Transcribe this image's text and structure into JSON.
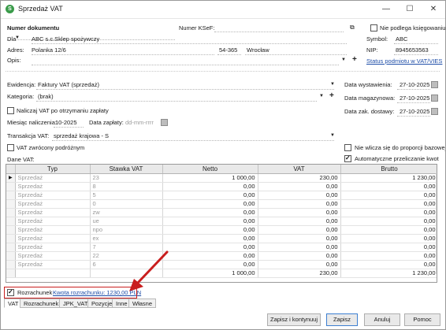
{
  "window": {
    "title": "Sprzedaż VAT",
    "minimize": "—",
    "maximize": "☐",
    "close": "✕"
  },
  "header": {
    "doc_number_label": "Numer dokumentu",
    "ksef_label": "Numer KSeF:",
    "not_booked_label": "Nie podlega księgowaniu",
    "dla_label": "Dla",
    "customer_name": "ABC s.c.Sklep spożywczy",
    "symbol_label": "Symbol:",
    "symbol_value": "ABC",
    "address_label": "Adres:",
    "street": "Polanka 12/6",
    "postal_code": "54-365",
    "city": "Wrocław",
    "nip_label": "NIP:",
    "nip_value": "8945653563",
    "opis_label": "Opis:",
    "vat_status_link": "Status podmiotu w VAT/VIES"
  },
  "details": {
    "ewidencja_label": "Ewidencja:",
    "ewidencja_value": "Faktury VAT (sprzedaż)",
    "kategoria_label": "Kategoria:",
    "kategoria_value": "(brak)",
    "naliczaj_label": "Naliczaj VAT po otrzymaniu zapłaty",
    "miesiac_label": "Miesiąc naliczenia:",
    "miesiac_value": "10-2025",
    "data_zaplaty_label": "Data zapłaty:",
    "data_zaplaty_placeholder": "dd-mm-rrrr",
    "transakcja_label": "Transakcja VAT:",
    "transakcja_value": "sprzedaż krajowa - S",
    "vat_zwrocony_label": "VAT zwrócony podróżnym",
    "dane_vat_label": "Dane VAT:",
    "data_wystawienia_label": "Data wystawienia:",
    "data_wystawienia_value": "27-10-2025",
    "data_magazynowa_label": "Data magazynowa:",
    "data_magazynowa_value": "27-10-2025",
    "data_zak_dostawy_label": "Data zak. dostawy:",
    "data_zak_dostawy_value": "27-10-2025",
    "nie_wlicza_label": "Nie wlicza się do proporcji bazowej",
    "auto_przelicz_label": "Automatyczne przeliczanie kwot"
  },
  "table": {
    "columns": [
      "Typ",
      "Stawka VAT",
      "Netto",
      "VAT",
      "Brutto"
    ],
    "rows": [
      [
        "Sprzedaż",
        "23",
        "1 000,00",
        "230,00",
        "1 230,00"
      ],
      [
        "Sprzedaż",
        "8",
        "0,00",
        "0,00",
        "0,00"
      ],
      [
        "Sprzedaż",
        "5",
        "0,00",
        "0,00",
        "0,00"
      ],
      [
        "Sprzedaż",
        "0",
        "0,00",
        "0,00",
        "0,00"
      ],
      [
        "Sprzedaż",
        "zw",
        "0,00",
        "0,00",
        "0,00"
      ],
      [
        "Sprzedaż",
        "ue",
        "0,00",
        "0,00",
        "0,00"
      ],
      [
        "Sprzedaż",
        "npo",
        "0,00",
        "0,00",
        "0,00"
      ],
      [
        "Sprzedaż",
        "ex",
        "0,00",
        "0,00",
        "0,00"
      ],
      [
        "Sprzedaż",
        "7",
        "0,00",
        "0,00",
        "0,00"
      ],
      [
        "Sprzedaż",
        "22",
        "0,00",
        "0,00",
        "0,00"
      ],
      [
        "Sprzedaż",
        "6",
        "0,00",
        "0,00",
        "0,00"
      ]
    ],
    "totals": {
      "netto": "1 000,00",
      "vat": "230,00",
      "brutto": "1 230,00"
    }
  },
  "footer": {
    "rozrachunek_label": "Rozrachunek",
    "kwota_link": "Kwota rozrachunku: 1230,00 PLN",
    "tabs": [
      "VAT",
      "Rozrachunek",
      "JPK_VAT",
      "Pozycje",
      "Inne",
      "Własne"
    ],
    "buttons": {
      "save_continue": "Zapisz i kontynuuj",
      "save": "Zapisz",
      "cancel": "Anuluj",
      "help": "Pomoc"
    }
  },
  "colors": {
    "annotation_red": "#c91e1e",
    "link_blue": "#1f4ea8",
    "primary_border": "#3c7fd1"
  }
}
